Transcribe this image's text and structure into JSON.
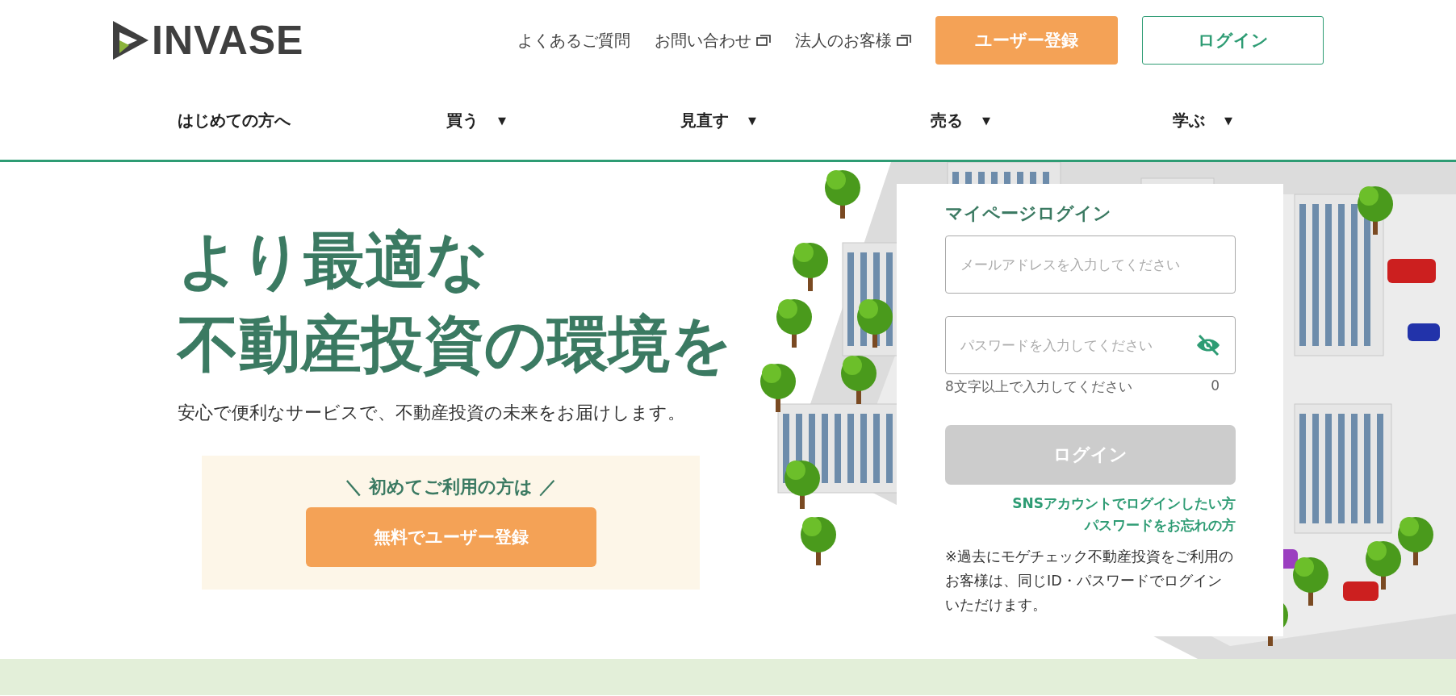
{
  "header": {
    "logo": "INVASE",
    "links": [
      {
        "label": "よくあるご質問",
        "external": false
      },
      {
        "label": "お問い合わせ",
        "external": true
      },
      {
        "label": "法人のお客様",
        "external": true
      }
    ],
    "register_button": "ユーザー登録",
    "login_button": "ログイン"
  },
  "nav": [
    {
      "label": "はじめての方へ",
      "dropdown": false
    },
    {
      "label": "買う",
      "dropdown": true,
      "caret": "▼"
    },
    {
      "label": "見直す",
      "dropdown": true,
      "caret": "▼"
    },
    {
      "label": "売る",
      "dropdown": true,
      "caret": "▼"
    },
    {
      "label": "学ぶ",
      "dropdown": true,
      "caret": "▼"
    }
  ],
  "hero": {
    "headline": [
      "より最適な",
      "不動産投資の環境を"
    ],
    "subtitle": "安心で便利なサービスで、不動産投資の未来をお届けします。",
    "cta": {
      "lead": "＼ 初めてご利用の方は ／",
      "button": "無料でユーザー登録"
    }
  },
  "login": {
    "title": "マイページログイン",
    "email": {
      "placeholder": "メールアドレスを入力してください"
    },
    "password": {
      "placeholder": "パスワードを入力してください",
      "hint": "8文字以上で入力してください",
      "count": "0",
      "visible": false
    },
    "submit": {
      "label": "ログイン",
      "disabled": true
    },
    "links": [
      "SNSアカウントでログインしたい方",
      "パスワードをお忘れの方"
    ],
    "note": "※過去にモゲチェック不動産投資をご利用のお客様は、同じID・パスワードでログインいただけます。"
  }
}
